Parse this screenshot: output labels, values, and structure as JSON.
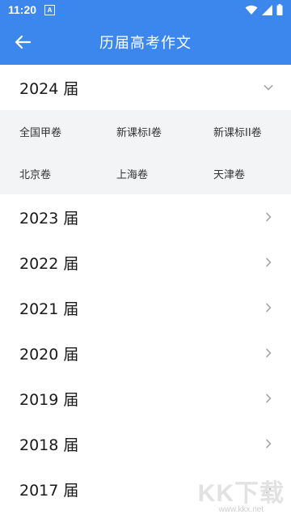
{
  "status_bar": {
    "time": "11:20",
    "notification_icon": "a-badge-icon",
    "wifi_icon": "wifi-icon",
    "signal_icon": "cell-signal-icon",
    "battery_icon": "battery-icon"
  },
  "app_bar": {
    "title": "历届高考作文",
    "back_icon": "arrow-left-icon",
    "background_color": "#3b87ee"
  },
  "expanded_year": {
    "label": "2024 届",
    "papers": [
      "全国甲卷",
      "新课标I卷",
      "新课标II卷",
      "北京卷",
      "上海卷",
      "天津卷"
    ]
  },
  "collapsed_years": [
    "2023 届",
    "2022 届",
    "2021 届",
    "2020 届",
    "2019 届",
    "2018 届",
    "2017 届"
  ],
  "watermark": {
    "logo_text": "KK下载",
    "url": "www.kkx.net"
  }
}
